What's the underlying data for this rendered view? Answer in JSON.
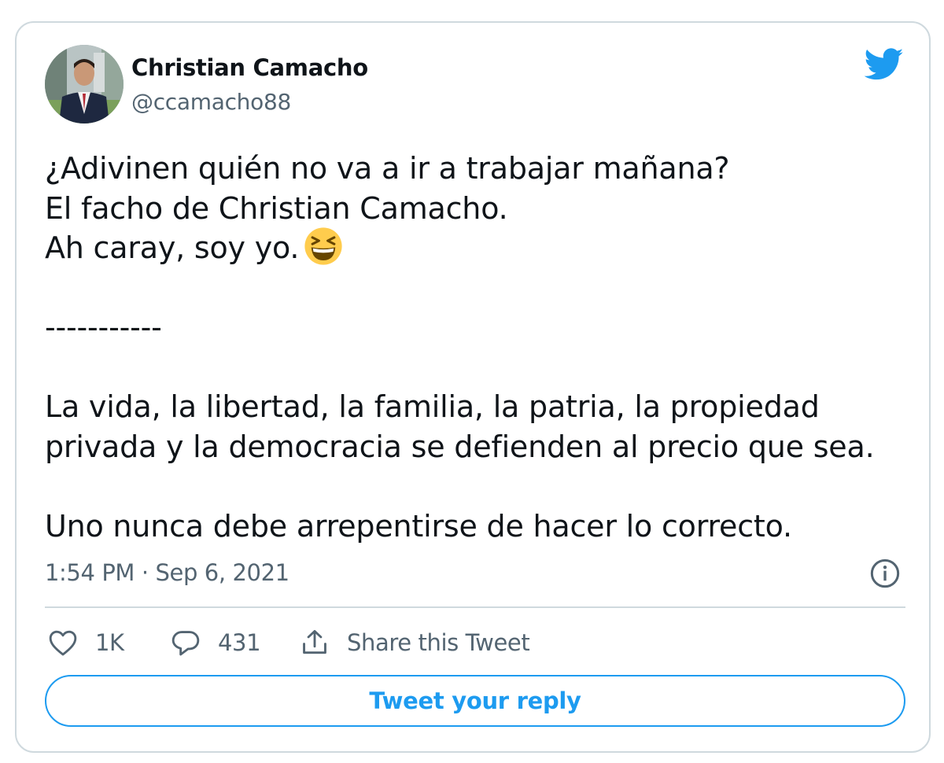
{
  "author": {
    "name": "Christian Camacho",
    "handle": "@ccamacho88"
  },
  "logo_icon": "twitter-bird-icon",
  "tweet": {
    "lines": [
      "¿Adivinen quién no va a ir a trabajar mañana?",
      "El facho de Christian Camacho.",
      "Ah caray, soy yo.",
      "",
      "-----------",
      "",
      "La vida, la libertad, la familia, la patria, la propiedad",
      "privada y la democracia se defienden al precio que sea.",
      "",
      "Uno nunca debe arrepentirse de hacer lo correcto."
    ],
    "emoji": "grinning-squinting-face-emoji",
    "timestamp": "1:54 PM · Sep 6, 2021"
  },
  "actions": {
    "likes_count": "1K",
    "replies_count": "431",
    "share_label": "Share this Tweet"
  },
  "reply_button_label": "Tweet your reply",
  "colors": {
    "accent": "#1d9bf0",
    "text_primary": "#0f1419",
    "text_secondary": "#536471",
    "border": "#cfd9de",
    "emoji_yellow": "#ffcc4d"
  }
}
